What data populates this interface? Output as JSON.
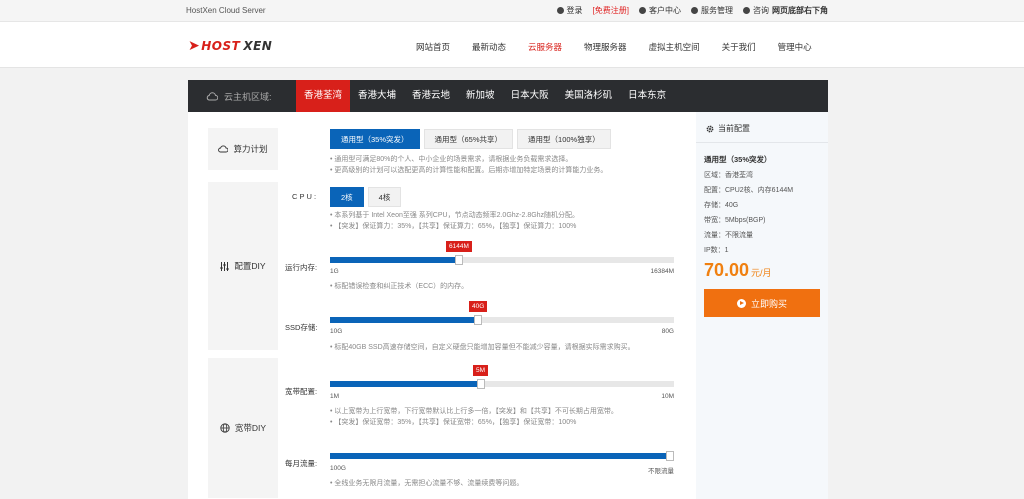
{
  "topbar": {
    "brand": "HostXen Cloud Server",
    "login": "登录",
    "register": "[免费注册]",
    "customer_center": "客户中心",
    "service_manage": "服务管理",
    "consult": "咨询",
    "consult_bold": "网页底部右下角"
  },
  "header": {
    "logo_prefix": "HOST",
    "logo_suffix": "XEN",
    "nav": [
      "网站首页",
      "最新动态",
      "云服务器",
      "物理服务器",
      "虚拟主机空间",
      "关于我们",
      "管理中心"
    ],
    "active_nav": "云服务器"
  },
  "region": {
    "label": "云主机区域:",
    "tabs": [
      "香港荃湾",
      "香港大埔",
      "香港云地",
      "新加坡",
      "日本大阪",
      "美国洛杉矶",
      "日本东京"
    ],
    "active": "香港荃湾"
  },
  "plan": {
    "side_label": "算力计划",
    "options": [
      "通用型（35%突发）",
      "通用型（65%共享）",
      "通用型（100%独享）"
    ],
    "selected": 0,
    "desc1": "• 通用型可满足80%的个人、中小企业的场景需求，请根据业务负载需求选择。",
    "desc2": "• 更高级别的计划可以选配更高的计算性能和配置。后期亦增加特定场景的计算能力业务。"
  },
  "config": {
    "side_label": "配置DIY",
    "cpu_label": "C P U :",
    "cpu_options": [
      "2核",
      "4核"
    ],
    "cpu_selected": 0,
    "cpu_desc1": "• 本系列基于 Intel Xeon至强 系列CPU，节点动态频率2.0Ghz-2.8Ghz随机分配。",
    "cpu_desc2": "• 【突发】保证算力：35%，【共享】保证算力：65%，【独享】保证算力：100%",
    "ram": {
      "label": "运行内存:",
      "value": "6144M",
      "min": "1G",
      "max": "16384M",
      "fraction": 0.375
    },
    "ram_desc": "• 标配错误检查和纠正技术（ECC）的内存。",
    "ssd": {
      "label": "SSD存储:",
      "value": "40G",
      "min": "10G",
      "max": "80G",
      "fraction": 0.43
    },
    "ssd_desc": "• 标配40GB SSD高速存储空间，自定义硬盘只能增加容量但不能减少容量，请根据实际需求购买。"
  },
  "bandwidth": {
    "side_label": "宽带DIY",
    "bw": {
      "label": "宽带配置:",
      "value": "5M",
      "min": "1M",
      "max": "10M",
      "fraction": 0.44
    },
    "bw_desc1": "• 以上宽带为上行宽带，下行宽带默认比上行多一倍，【突发】和【共享】不可长期占用宽带。",
    "bw_desc2": "• 【突发】保证宽带：35%，【共享】保证宽带：65%，【独享】保证宽带：100%",
    "traffic": {
      "label": "每月流量:",
      "min": "100G",
      "max": "不限流量",
      "fraction": 1.0
    },
    "traffic_desc": "• 全线业务无限月流量，无需担心流量不够、流量续费等问题。"
  },
  "summary": {
    "title": "当前配置",
    "plan": "通用型（35%突发）",
    "rows": [
      "区域：香港荃湾",
      "配置：CPU2核、内存6144M",
      "存储：40G",
      "带宽：5Mbps(BGP)",
      "流量：不限流量",
      "IP数：1"
    ],
    "price": "70.00",
    "unit": "元/月",
    "buy": "立即购买"
  },
  "colors": {
    "accent_red": "#d8201a",
    "primary_blue": "#0a64b8",
    "buy_orange": "#f07010"
  }
}
